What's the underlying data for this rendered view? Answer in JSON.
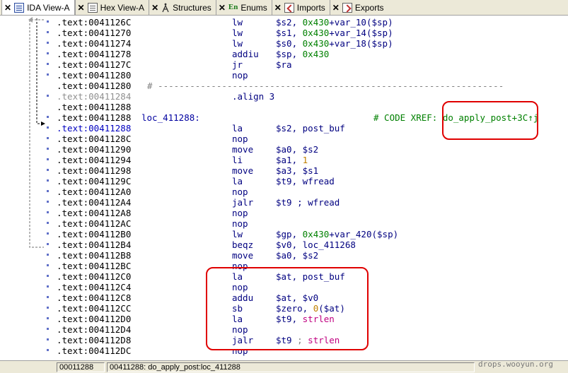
{
  "tabs": [
    {
      "label": "IDA View-A",
      "icon": "ida-view-icon",
      "active": true
    },
    {
      "label": "Hex View-A",
      "icon": "hex-view-icon",
      "active": false
    },
    {
      "label": "Structures",
      "icon": "structures-icon",
      "active": false
    },
    {
      "label": "Enums",
      "icon_text": "En",
      "icon": "enums-icon",
      "active": false
    },
    {
      "label": "Imports",
      "icon": "imports-icon",
      "active": false
    },
    {
      "label": "Exports",
      "icon": "exports-icon",
      "active": false
    }
  ],
  "close_glyph": "✕",
  "code_lines": [
    {
      "addr": ".text:0041126C",
      "mn": "lw",
      "ops": [
        {
          "t": "$s2, ",
          "c": "reg"
        },
        {
          "t": "0x430",
          "c": "num"
        },
        {
          "t": "+var_10($sp)",
          "c": "reg"
        }
      ]
    },
    {
      "addr": ".text:00411270",
      "mn": "lw",
      "ops": [
        {
          "t": "$s1, ",
          "c": "reg"
        },
        {
          "t": "0x430",
          "c": "num"
        },
        {
          "t": "+var_14($sp)",
          "c": "reg"
        }
      ]
    },
    {
      "addr": ".text:00411274",
      "mn": "lw",
      "ops": [
        {
          "t": "$s0, ",
          "c": "reg"
        },
        {
          "t": "0x430",
          "c": "num"
        },
        {
          "t": "+var_18($sp)",
          "c": "reg"
        }
      ]
    },
    {
      "addr": ".text:00411278",
      "mn": "addiu",
      "ops": [
        {
          "t": "$sp, ",
          "c": "reg"
        },
        {
          "t": "0x430",
          "c": "num"
        }
      ]
    },
    {
      "addr": ".text:0041127C",
      "mn": "jr",
      "ops": [
        {
          "t": "$ra",
          "c": "reg"
        }
      ]
    },
    {
      "addr": ".text:00411280",
      "mn": "nop",
      "ops": []
    },
    {
      "addr": ".text:00411280",
      "sep": "# -----------------------------------------------------------------"
    },
    {
      "addr": ".text:00411284",
      "addr_style": "gray",
      "mn": ".align 3",
      "ops": []
    },
    {
      "addr": ".text:00411288",
      "mn": "",
      "ops": []
    },
    {
      "addr": ".text:00411288",
      "label": "loc_411288:",
      "xref": "# CODE XREF: do_apply_post+3C↑j"
    },
    {
      "addr": ".text:00411288",
      "addr_style": "blue",
      "mn": "la",
      "ops": [
        {
          "t": "$s2, post_buf",
          "c": "reg"
        }
      ]
    },
    {
      "addr": ".text:0041128C",
      "mn": "nop",
      "ops": []
    },
    {
      "addr": ".text:00411290",
      "mn": "move",
      "ops": [
        {
          "t": "$a0, $s2",
          "c": "reg"
        }
      ]
    },
    {
      "addr": ".text:00411294",
      "mn": "li",
      "ops": [
        {
          "t": "$a1, ",
          "c": "reg"
        },
        {
          "t": "1",
          "c": "imm"
        }
      ]
    },
    {
      "addr": ".text:00411298",
      "mn": "move",
      "ops": [
        {
          "t": "$a3, $s1",
          "c": "reg"
        }
      ]
    },
    {
      "addr": ".text:0041129C",
      "mn": "la",
      "ops": [
        {
          "t": "$t9, wfread",
          "c": "reg"
        }
      ]
    },
    {
      "addr": ".text:004112A0",
      "mn": "nop",
      "ops": []
    },
    {
      "addr": ".text:004112A4",
      "mn": "jalr",
      "ops": [
        {
          "t": "$t9 ",
          "c": "reg"
        },
        {
          "t": "; wfread",
          "c": "reg"
        }
      ]
    },
    {
      "addr": ".text:004112A8",
      "mn": "nop",
      "ops": []
    },
    {
      "addr": ".text:004112AC",
      "mn": "nop",
      "ops": []
    },
    {
      "addr": ".text:004112B0",
      "mn": "lw",
      "ops": [
        {
          "t": "$gp, ",
          "c": "reg"
        },
        {
          "t": "0x430",
          "c": "num"
        },
        {
          "t": "+var_420($sp)",
          "c": "reg"
        }
      ]
    },
    {
      "addr": ".text:004112B4",
      "mn": "beqz",
      "ops": [
        {
          "t": "$v0, loc_411268",
          "c": "reg"
        }
      ]
    },
    {
      "addr": ".text:004112B8",
      "mn": "move",
      "ops": [
        {
          "t": "$a0, $s2",
          "c": "reg"
        }
      ]
    },
    {
      "addr": ".text:004112BC",
      "mn": "nop",
      "ops": []
    },
    {
      "addr": ".text:004112C0",
      "mn": "la",
      "ops": [
        {
          "t": "$at, post_buf",
          "c": "reg"
        }
      ]
    },
    {
      "addr": ".text:004112C4",
      "mn": "nop",
      "ops": []
    },
    {
      "addr": ".text:004112C8",
      "mn": "addu",
      "ops": [
        {
          "t": "$at, $v0",
          "c": "reg"
        }
      ]
    },
    {
      "addr": ".text:004112CC",
      "mn": "sb",
      "ops": [
        {
          "t": "$zero, ",
          "c": "reg"
        },
        {
          "t": "0",
          "c": "imm"
        },
        {
          "t": "($at)",
          "c": "reg"
        }
      ]
    },
    {
      "addr": ".text:004112D0",
      "mn": "la",
      "ops": [
        {
          "t": "$t9, ",
          "c": "reg"
        },
        {
          "t": "strlen",
          "c": "func"
        }
      ]
    },
    {
      "addr": ".text:004112D4",
      "mn": "nop",
      "ops": []
    },
    {
      "addr": ".text:004112D8",
      "mn": "jalr",
      "ops": [
        {
          "t": "$t9 ",
          "c": "reg"
        },
        {
          "t": "; ",
          "c": "cmt"
        },
        {
          "t": "strlen",
          "c": "func"
        }
      ]
    },
    {
      "addr": ".text:004112DC",
      "mn": "nop",
      "ops": []
    }
  ],
  "status": {
    "offset": "00011288",
    "location": "00411288: do_apply_post:loc_411288"
  },
  "watermark": "drops.wooyun.org",
  "colors": {
    "annotation": "#e00000",
    "tab_bar": "#ece9d8",
    "dot_marker": "#6070c8"
  }
}
